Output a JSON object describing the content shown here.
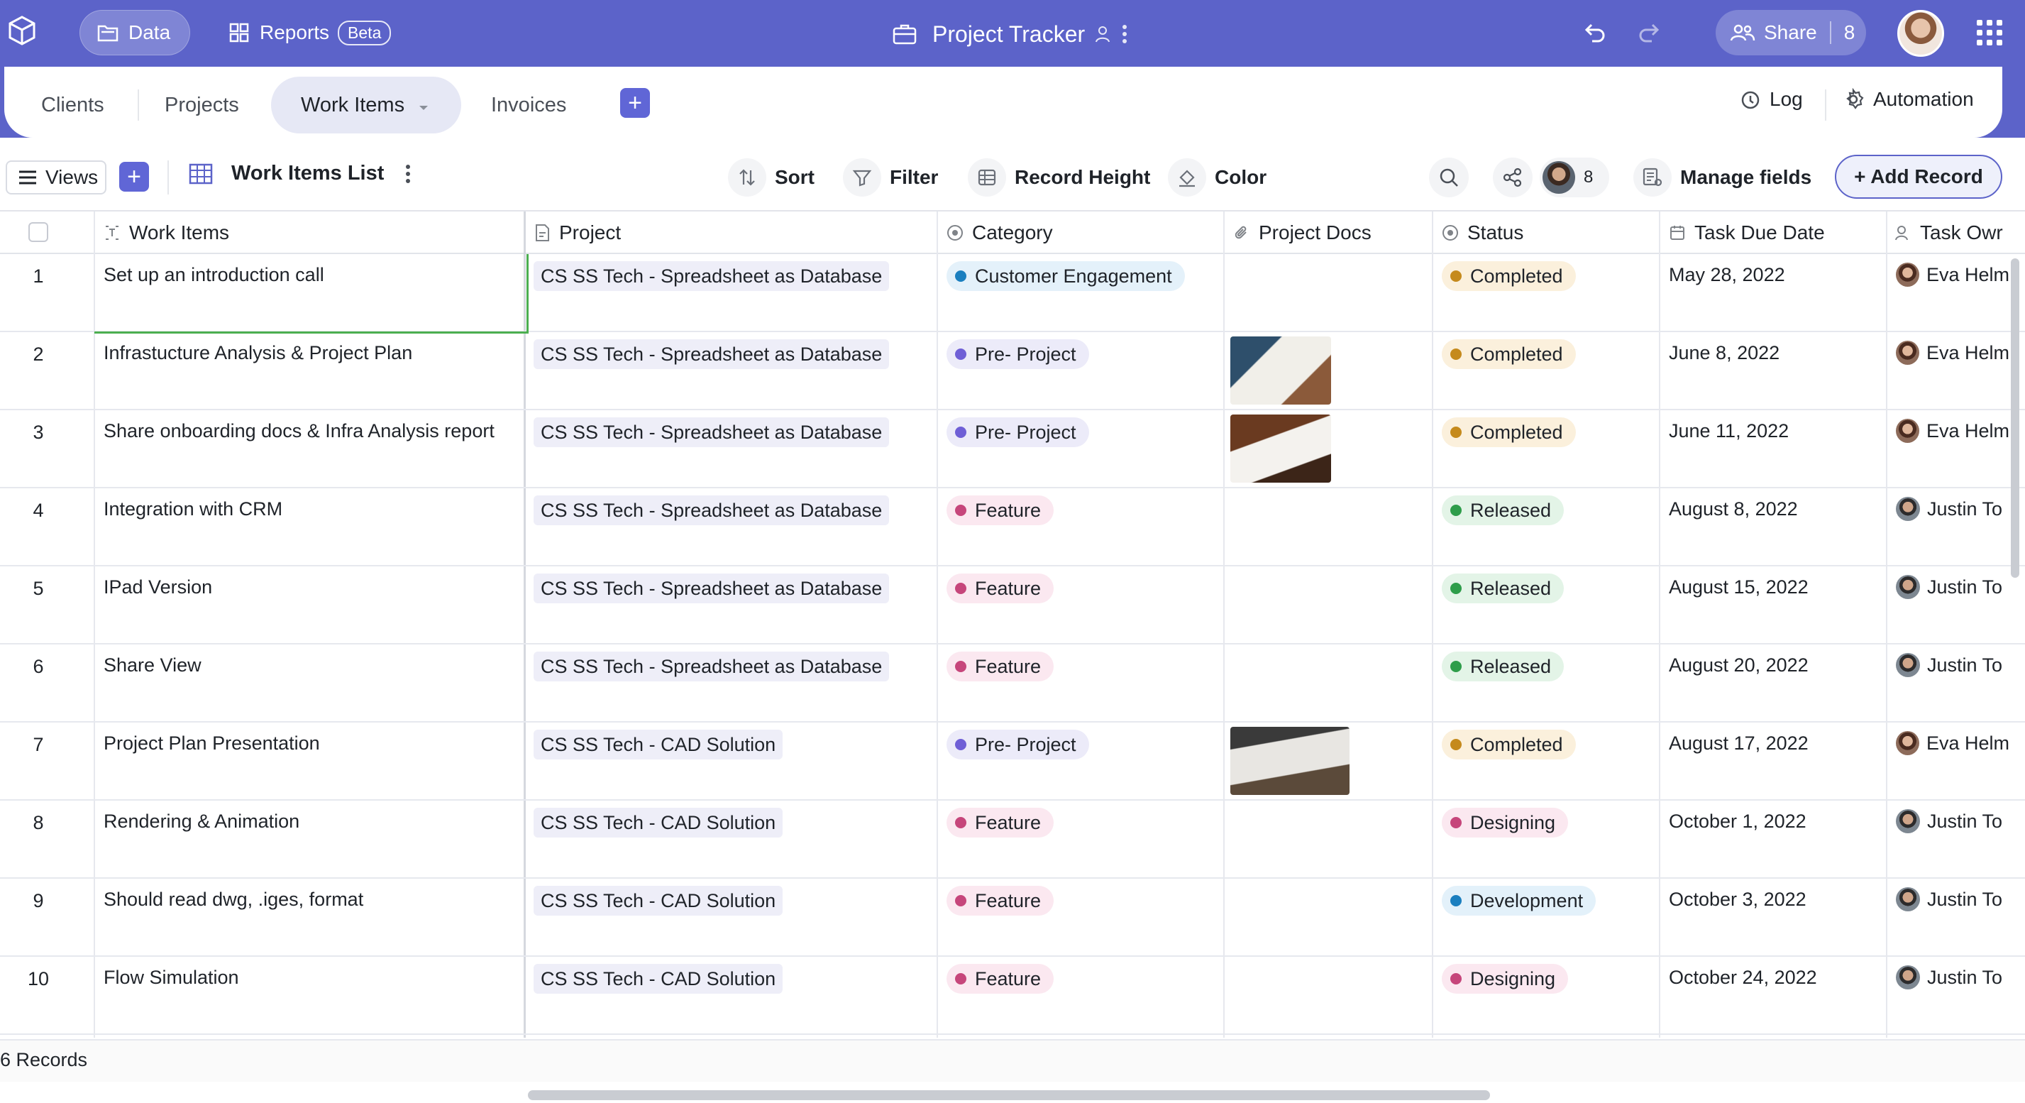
{
  "topbar": {
    "data_label": "Data",
    "reports_label": "Reports",
    "beta_label": "Beta",
    "title": "Project Tracker",
    "share_label": "Share",
    "share_count": "8"
  },
  "tabs": {
    "clients": "Clients",
    "projects": "Projects",
    "work_items": "Work Items",
    "invoices": "Invoices",
    "log": "Log",
    "automation": "Automation"
  },
  "toolbar": {
    "views_label": "Views",
    "view_name": "Work Items List",
    "sort_label": "Sort",
    "filter_label": "Filter",
    "record_height_label": "Record Height",
    "color_label": "Color",
    "collaborator_count": "8",
    "manage_fields_label": "Manage fields",
    "add_record_label": "+ Add Record"
  },
  "columns": {
    "work_items": "Work Items",
    "project": "Project",
    "category": "Category",
    "project_docs": "Project Docs",
    "status": "Status",
    "task_due_date": "Task Due Date",
    "task_owner": "Task Owr"
  },
  "colors": {
    "accent": "#5c63c9",
    "completed": "#c58a1c",
    "released": "#2e9d4a",
    "designing": "#c6467b",
    "development": "#1b7fbf",
    "feature": "#c6467b",
    "pre_project": "#6f5fd6",
    "customer_engagement": "#1b7fbf"
  },
  "rows": [
    {
      "num": "1",
      "item": "Set up an introduction call",
      "project": "CS SS Tech - Spreadsheet as Database",
      "category": "Customer Engagement",
      "status": "Completed",
      "due": "May 28, 2022",
      "owner": "Eva Helm"
    },
    {
      "num": "2",
      "item": "Infrastucture Analysis & Project Plan",
      "project": "CS SS Tech - Spreadsheet as Database",
      "category": "Pre- Project",
      "status": "Completed",
      "due": "June 8, 2022",
      "owner": "Eva Helm"
    },
    {
      "num": "3",
      "item": "Share onboarding docs & Infra Analysis report",
      "project": "CS SS Tech - Spreadsheet as Database",
      "category": "Pre- Project",
      "status": "Completed",
      "due": "June 11, 2022",
      "owner": "Eva Helm"
    },
    {
      "num": "4",
      "item": "Integration with CRM",
      "project": "CS SS Tech - Spreadsheet as Database",
      "category": "Feature",
      "status": "Released",
      "due": "August 8, 2022",
      "owner": "Justin To"
    },
    {
      "num": "5",
      "item": "IPad Version",
      "project": "CS SS Tech - Spreadsheet as Database",
      "category": "Feature",
      "status": "Released",
      "due": "August 15, 2022",
      "owner": "Justin To"
    },
    {
      "num": "6",
      "item": "Share View",
      "project": "CS SS Tech - Spreadsheet as Database",
      "category": "Feature",
      "status": "Released",
      "due": "August 20, 2022",
      "owner": "Justin To"
    },
    {
      "num": "7",
      "item": "Project Plan Presentation",
      "project": "CS SS Tech - CAD Solution",
      "category": "Pre- Project",
      "status": "Completed",
      "due": "August 17, 2022",
      "owner": "Eva Helm"
    },
    {
      "num": "8",
      "item": "Rendering & Animation",
      "project": "CS SS Tech - CAD Solution",
      "category": "Feature",
      "status": "Designing",
      "due": "October 1, 2022",
      "owner": "Justin To"
    },
    {
      "num": "9",
      "item": "Should read dwg, .iges, format",
      "project": "CS SS Tech - CAD Solution",
      "category": "Feature",
      "status": "Development",
      "due": "October 3, 2022",
      "owner": "Justin To"
    },
    {
      "num": "10",
      "item": "Flow Simulation",
      "project": "CS SS Tech - CAD Solution",
      "category": "Feature",
      "status": "Designing",
      "due": "October 24, 2022",
      "owner": "Justin To"
    }
  ],
  "footer": {
    "records_label": "6 Records"
  }
}
